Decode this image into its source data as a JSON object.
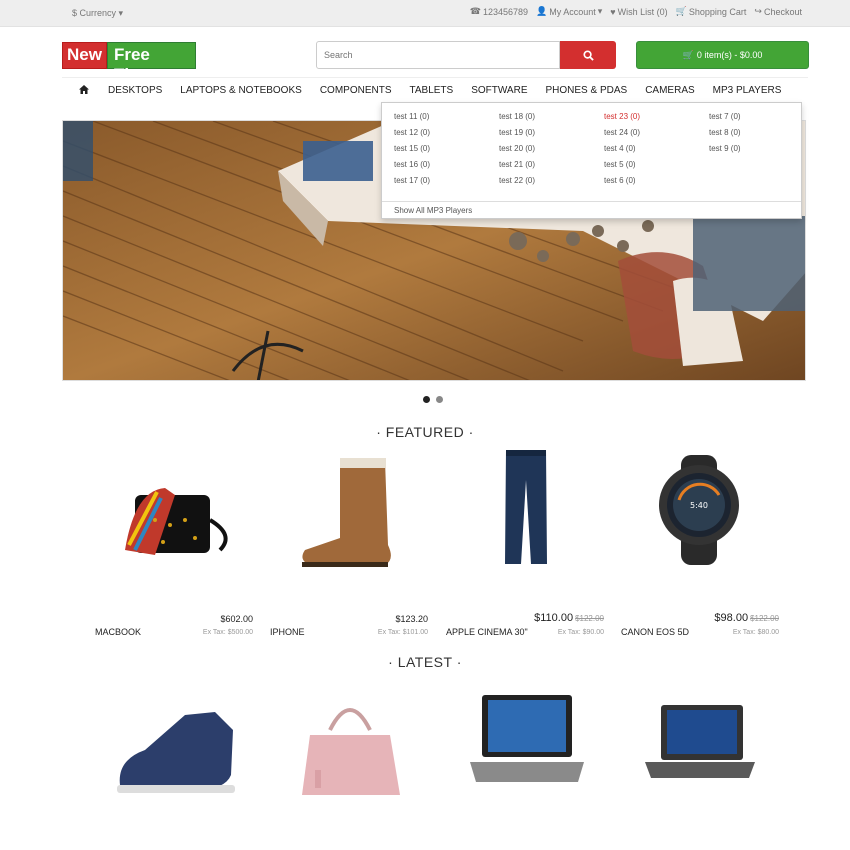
{
  "topbar": {
    "currency": "$ Currency",
    "phone": "123456789",
    "my_account": "My Account",
    "wish_list": "Wish List (0)",
    "shopping_cart": "Shopping Cart",
    "checkout": "Checkout"
  },
  "logo": {
    "part1": "New",
    "part2": "Free Theme"
  },
  "search": {
    "placeholder": "Search"
  },
  "cart": {
    "label": "0 item(s) - $0.00"
  },
  "menu": [
    "DESKTOPS",
    "LAPTOPS & NOTEBOOKS",
    "COMPONENTS",
    "TABLETS",
    "SOFTWARE",
    "PHONES & PDAS",
    "CAMERAS",
    "MP3 PLAYERS"
  ],
  "dropdown": {
    "items": [
      "test 11 (0)",
      "test 18 (0)",
      "test 23 (0)",
      "test 7 (0)",
      "test 12 (0)",
      "test 19 (0)",
      "test 24 (0)",
      "test 8 (0)",
      "test 15 (0)",
      "test 20 (0)",
      "test 4 (0)",
      "test 9 (0)",
      "test 16 (0)",
      "test 21 (0)",
      "test 5 (0)",
      "",
      "test 17 (0)",
      "test 22 (0)",
      "test 6 (0)",
      ""
    ],
    "show_all": "Show All MP3 Players"
  },
  "sections": {
    "featured": "· FEATURED ·",
    "latest": "· LATEST ·"
  },
  "featured": [
    {
      "name": "MACBOOK",
      "price": "$602.00",
      "old": "",
      "tax": "Ex Tax: $500.00"
    },
    {
      "name": "IPHONE",
      "price": "$123.20",
      "old": "",
      "tax": "Ex Tax: $101.00"
    },
    {
      "name": "APPLE CINEMA 30\"",
      "price": "$110.00",
      "old": "$122.00",
      "tax": "Ex Tax: $90.00"
    },
    {
      "name": "CANON EOS 5D",
      "price": "$98.00",
      "old": "$122.00",
      "tax": "Ex Tax: $80.00"
    }
  ],
  "colors": {
    "red": "#d32f2f",
    "green": "#43a536"
  }
}
